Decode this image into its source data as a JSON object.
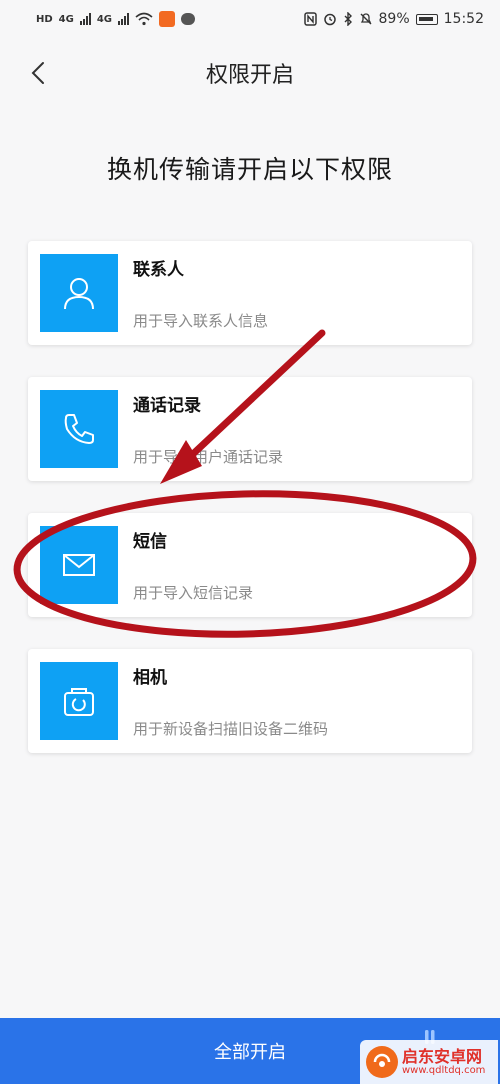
{
  "status_bar": {
    "left_indicators": [
      "HD",
      "4G",
      "4G"
    ],
    "battery": "89%",
    "time": "15:52"
  },
  "header": {
    "title": "权限开启"
  },
  "subtitle": "换机传输请开启以下权限",
  "permissions": [
    {
      "title": "联系人",
      "desc": "用于导入联系人信息",
      "icon": "person-icon"
    },
    {
      "title": "通话记录",
      "desc": "用于导入用户通话记录",
      "icon": "phone-icon"
    },
    {
      "title": "短信",
      "desc": "用于导入短信记录",
      "icon": "mail-icon"
    },
    {
      "title": "相机",
      "desc": "用于新设备扫描旧设备二维码",
      "icon": "camera-icon"
    }
  ],
  "bottom_button": {
    "label": "全部开启"
  },
  "watermark": {
    "title": "启东安卓网",
    "url": "www.qdltdq.com"
  },
  "colors": {
    "accent": "#0ea1f4",
    "bottom_bar": "#2a73e8",
    "annotation": "#b5121b"
  }
}
